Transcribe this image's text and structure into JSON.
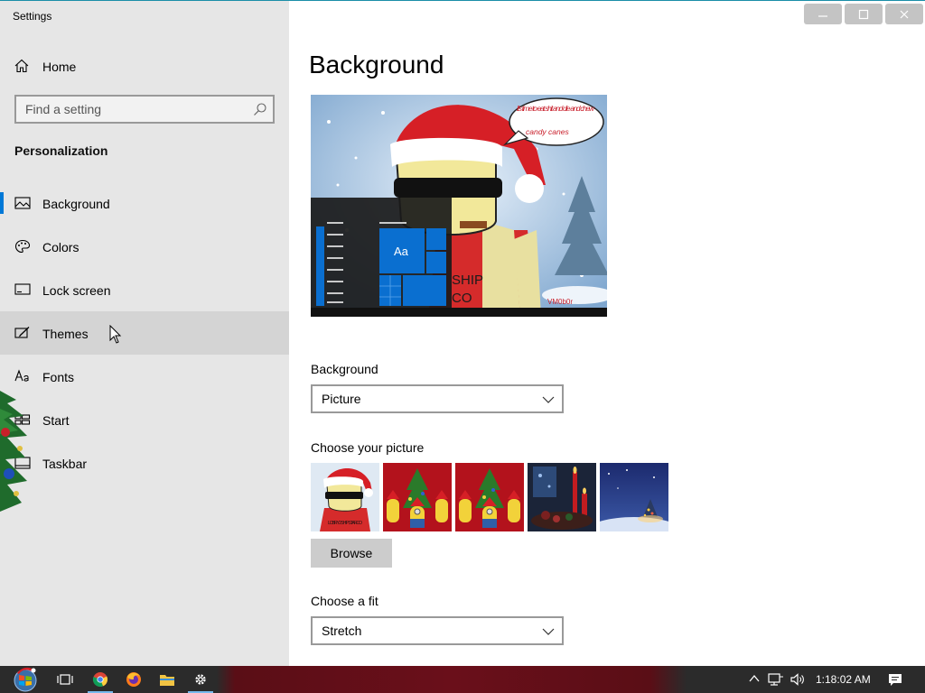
{
  "window": {
    "app_title": "Settings"
  },
  "sidebar": {
    "home_label": "Home",
    "search_placeholder": "Find a setting",
    "section_title": "Personalization",
    "items": [
      {
        "label": "Background",
        "icon": "picture-icon",
        "active": true
      },
      {
        "label": "Colors",
        "icon": "palette-icon",
        "active": false
      },
      {
        "label": "Lock screen",
        "icon": "lock-screen-icon",
        "active": false
      },
      {
        "label": "Themes",
        "icon": "themes-icon",
        "active": false,
        "hovered": true
      },
      {
        "label": "Fonts",
        "icon": "fonts-icon",
        "active": false
      },
      {
        "label": "Start",
        "icon": "start-icon",
        "active": false
      },
      {
        "label": "Taskbar",
        "icon": "taskbar-icon",
        "active": false
      }
    ]
  },
  "main": {
    "page_title": "Background",
    "preview": {
      "speech_bubble": "it's time to eat shit and die and chew",
      "speech_bubble_tail": "candy canes",
      "tile_label": "Aa",
      "shirt_text_1": "SHIP",
      "shirt_text_2": "CO",
      "signature": "VM0b0r"
    },
    "background_label": "Background",
    "background_value": "Picture",
    "choose_picture_label": "Choose your picture",
    "thumbnail_1_caption": "LOBRY 2 SHIP STARCO",
    "thumbnails": [
      "santa-character-thumbnail",
      "minions-christmas-thumbnail",
      "minions-christmas-thumbnail-2",
      "candles-thumbnail",
      "winter-night-thumbnail"
    ],
    "browse_label": "Browse",
    "fit_label": "Choose a fit",
    "fit_value": "Stretch"
  },
  "taskbar": {
    "clock": "1:18:02 AM",
    "pinned": [
      "start-orb-icon",
      "task-view-icon",
      "chrome-icon",
      "firefox-icon",
      "file-explorer-icon",
      "settings-icon"
    ]
  },
  "colors": {
    "accent": "#0078d7",
    "sidebar_bg": "#e6e6e6",
    "taskbar_bg": "#2b2b2b"
  }
}
